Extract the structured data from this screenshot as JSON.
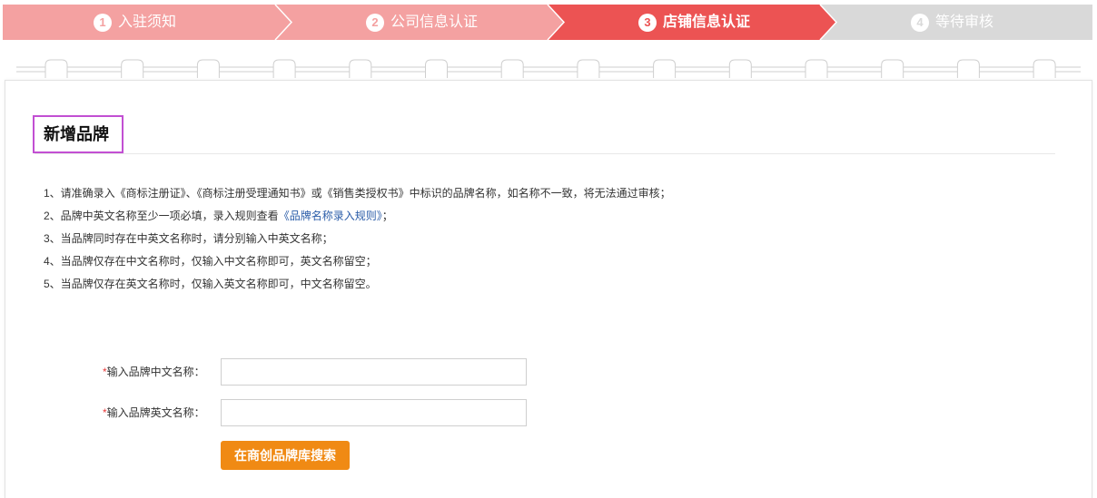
{
  "steps": [
    {
      "num": "1",
      "label": "入驻须知",
      "state": "done"
    },
    {
      "num": "2",
      "label": "公司信息认证",
      "state": "done"
    },
    {
      "num": "3",
      "label": "店铺信息认证",
      "state": "current"
    },
    {
      "num": "4",
      "label": "等待审核",
      "state": "pending"
    }
  ],
  "colors": {
    "step_done": "#f4a1a1",
    "step_current": "#ec5353",
    "step_pending": "#d9d9d9",
    "title_highlight": "#c24fd3",
    "link": "#2a5ca8",
    "required": "#e83a3a",
    "button": "#f08a14"
  },
  "section": {
    "title": "新增品牌"
  },
  "notes": {
    "n1": "1、请准确录入《商标注册证》、《商标注册受理通知书》或《销售类授权书》中标识的品牌名称，如名称不一致，将无法通过审核；",
    "n2_before": "2、品牌中英文名称至少一项必填，录入规则查看",
    "n2_link": "《品牌名称录入规则》",
    "n2_after": "；",
    "n3": "3、当品牌同时存在中英文名称时，请分别输入中英文名称；",
    "n4": "4、当品牌仅存在中文名称时，仅输入中文名称即可，英文名称留空；",
    "n5": "5、当品牌仅存在英文名称时，仅输入英文名称即可，中文名称留空。"
  },
  "form": {
    "required_mark": "*",
    "cn_label": "输入品牌中文名称：",
    "cn_value": "",
    "en_label": "输入品牌英文名称：",
    "en_value": "",
    "search_button": "在商创品牌库搜索"
  }
}
